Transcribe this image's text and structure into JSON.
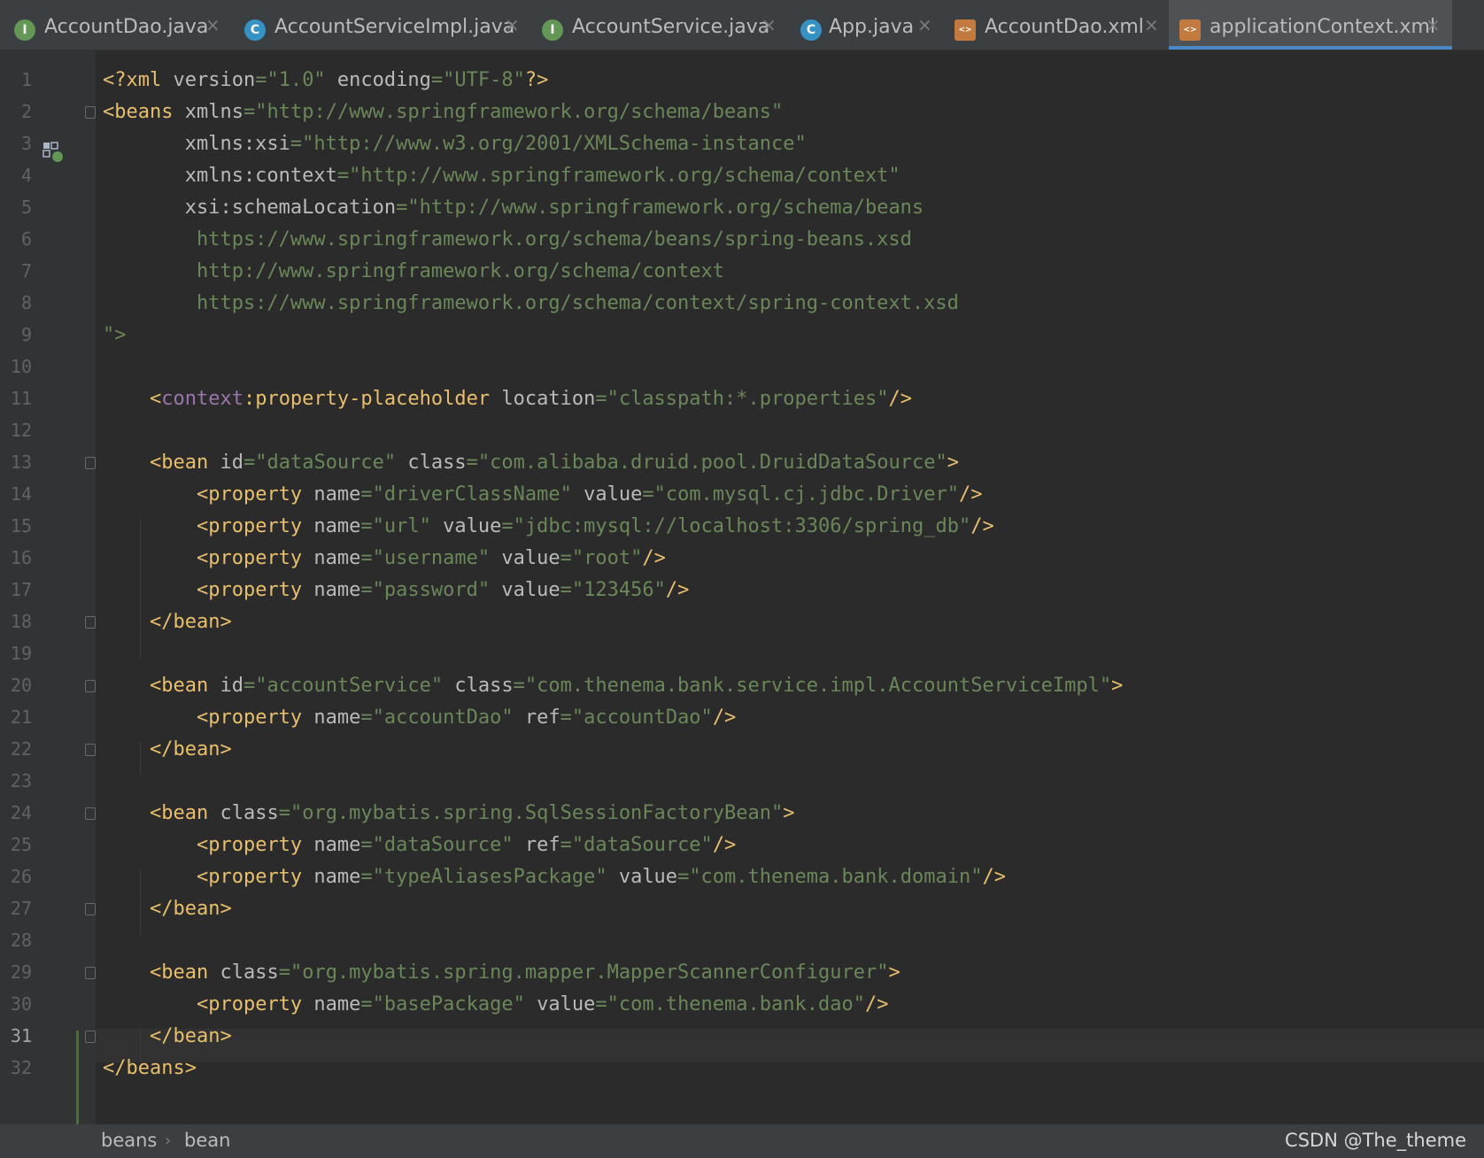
{
  "tabs": [
    {
      "label": "AccountDao.java",
      "icon": "I",
      "type": "interface"
    },
    {
      "label": "AccountServiceImpl.java",
      "icon": "C",
      "type": "class"
    },
    {
      "label": "AccountService.java",
      "icon": "I",
      "type": "interface"
    },
    {
      "label": "App.java",
      "icon": "C",
      "type": "class"
    },
    {
      "label": "AccountDao.xml",
      "icon": "<>",
      "type": "xml"
    },
    {
      "label": "applicationContext.xml",
      "icon": "<>",
      "type": "xml",
      "active": true
    }
  ],
  "close_glyph": "×",
  "editor": {
    "current_line": 31,
    "line_numbers": [
      "1",
      "2",
      "3",
      "4",
      "5",
      "6",
      "7",
      "8",
      "9",
      "10",
      "11",
      "12",
      "13",
      "14",
      "15",
      "16",
      "17",
      "18",
      "19",
      "20",
      "21",
      "22",
      "23",
      "24",
      "25",
      "26",
      "27",
      "28",
      "29",
      "30",
      "31",
      "32"
    ],
    "lines": [
      "<?xml version=\"1.0\" encoding=\"UTF-8\"?>",
      "<beans xmlns=\"http://www.springframework.org/schema/beans\"",
      "       xmlns:xsi=\"http://www.w3.org/2001/XMLSchema-instance\"",
      "       xmlns:context=\"http://www.springframework.org/schema/context\"",
      "       xsi:schemaLocation=\"http://www.springframework.org/schema/beans",
      "        https://www.springframework.org/schema/beans/spring-beans.xsd",
      "        http://www.springframework.org/schema/context",
      "        https://www.springframework.org/schema/context/spring-context.xsd",
      "\">",
      "",
      "    <context:property-placeholder location=\"classpath:*.properties\"/>",
      "",
      "    <bean id=\"dataSource\" class=\"com.alibaba.druid.pool.DruidDataSource\">",
      "        <property name=\"driverClassName\" value=\"com.mysql.cj.jdbc.Driver\"/>",
      "        <property name=\"url\" value=\"jdbc:mysql://localhost:3306/spring_db\"/>",
      "        <property name=\"username\" value=\"root\"/>",
      "        <property name=\"password\" value=\"123456\"/>",
      "    </bean>",
      "",
      "    <bean id=\"accountService\" class=\"com.thenema.bank.service.impl.AccountServiceImpl\">",
      "        <property name=\"accountDao\" ref=\"accountDao\"/>",
      "    </bean>",
      "",
      "    <bean class=\"org.mybatis.spring.SqlSessionFactoryBean\">",
      "        <property name=\"dataSource\" ref=\"dataSource\"/>",
      "        <property name=\"typeAliasesPackage\" value=\"com.thenema.bank.domain\"/>",
      "    </bean>",
      "",
      "    <bean class=\"org.mybatis.spring.mapper.MapperScannerConfigurer\">",
      "        <property name=\"basePackage\" value=\"com.thenema.bank.dao\"/>",
      "    </bean>",
      "</beans>"
    ]
  },
  "breadcrumb": [
    "beans",
    "bean"
  ],
  "breadcrumb_sep": "›",
  "watermark": "CSDN @The_theme",
  "colors": {
    "tag": "#e8bf6a",
    "attribute": "#bababa",
    "string": "#6a8759",
    "namespace": "#9876aa",
    "accent": "#4a88c7"
  }
}
